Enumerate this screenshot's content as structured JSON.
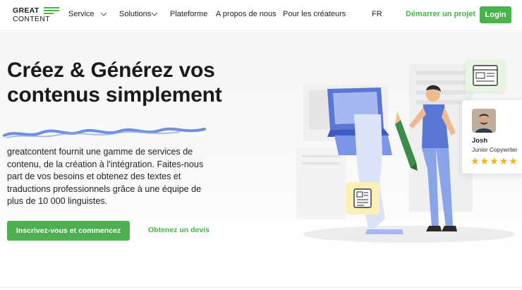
{
  "nav": {
    "logo_top": "GREAT",
    "logo_bottom": "CONTENT",
    "items": [
      {
        "label": "Service",
        "has_dropdown": true
      },
      {
        "label": "Solutions",
        "has_dropdown": true
      },
      {
        "label": "Plateforme",
        "has_dropdown": false
      },
      {
        "label": "A propos de nous",
        "has_dropdown": false
      },
      {
        "label": "Pour les créateurs",
        "has_dropdown": false
      }
    ],
    "language": "FR",
    "cta": "Démarrer un projet",
    "login": "Login"
  },
  "hero": {
    "headline": "Créez & Générez vos contenus simplement",
    "description": "greatcontent fournit une gamme de services de contenu, de la création à l'intégration. Faites-nous part de vos besoins et obtenez des textes et traductions professionnels grâce à une équipe de plus de 10 000 linguistes.",
    "primary_button": "Inscrivez-vous et commencez",
    "secondary_link": "Obtenez un devis"
  },
  "profile_card": {
    "name": "Josh",
    "role": "Junior Copywriter",
    "stars": "★★★★★",
    "rating": 5
  },
  "colors": {
    "brand_green": "#48b24b",
    "scribble_blue": "#6f8fe0",
    "star": "#f5b316"
  }
}
